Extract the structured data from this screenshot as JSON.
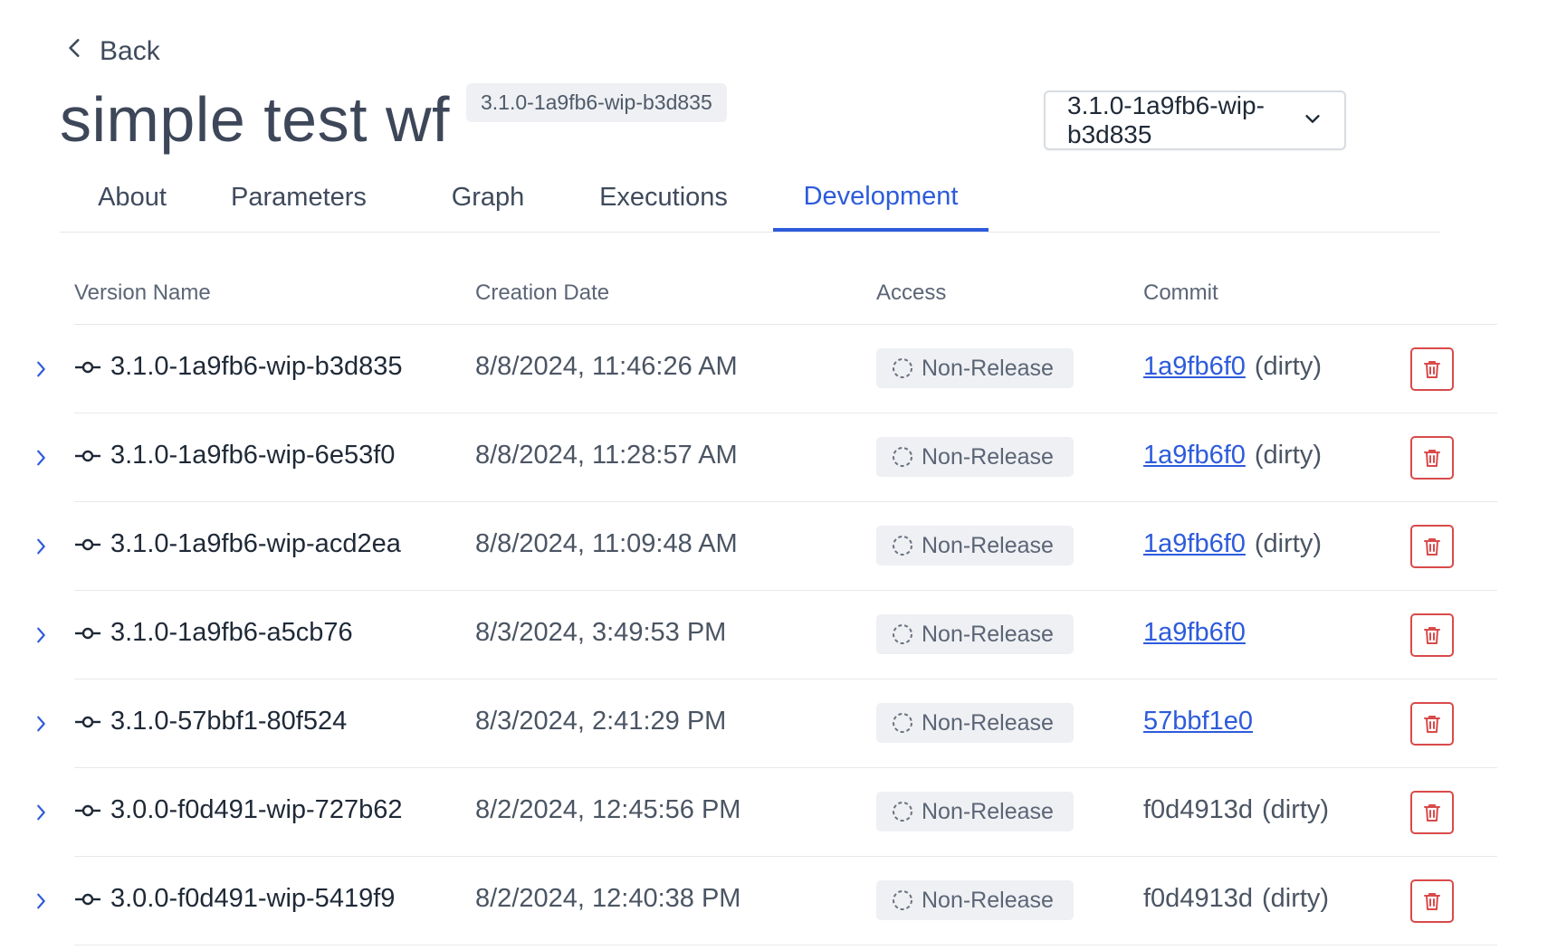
{
  "nav": {
    "back_label": "Back"
  },
  "header": {
    "title": "simple test wf",
    "version_chip": "3.1.0-1a9fb6-wip-b3d835",
    "version_select": "3.1.0-1a9fb6-wip-b3d835"
  },
  "tabs": [
    {
      "label": "About"
    },
    {
      "label": "Parameters"
    },
    {
      "label": "Graph"
    },
    {
      "label": "Executions"
    },
    {
      "label": "Development",
      "active": true
    }
  ],
  "table": {
    "columns": [
      "Version Name",
      "Creation Date",
      "Access",
      "Commit"
    ],
    "rows": [
      {
        "version": "3.1.0-1a9fb6-wip-b3d835",
        "date": "8/8/2024, 11:46:26 AM",
        "access": "Non-Release",
        "commit": "1a9fb6f0",
        "commit_is_link": true,
        "suffix": "(dirty)"
      },
      {
        "version": "3.1.0-1a9fb6-wip-6e53f0",
        "date": "8/8/2024, 11:28:57 AM",
        "access": "Non-Release",
        "commit": "1a9fb6f0",
        "commit_is_link": true,
        "suffix": "(dirty)"
      },
      {
        "version": "3.1.0-1a9fb6-wip-acd2ea",
        "date": "8/8/2024, 11:09:48 AM",
        "access": "Non-Release",
        "commit": "1a9fb6f0",
        "commit_is_link": true,
        "suffix": "(dirty)"
      },
      {
        "version": "3.1.0-1a9fb6-a5cb76",
        "date": "8/3/2024, 3:49:53 PM",
        "access": "Non-Release",
        "commit": "1a9fb6f0",
        "commit_is_link": true,
        "suffix": ""
      },
      {
        "version": "3.1.0-57bbf1-80f524",
        "date": "8/3/2024, 2:41:29 PM",
        "access": "Non-Release",
        "commit": "57bbf1e0",
        "commit_is_link": true,
        "suffix": ""
      },
      {
        "version": "3.0.0-f0d491-wip-727b62",
        "date": "8/2/2024, 12:45:56 PM",
        "access": "Non-Release",
        "commit": "f0d4913d",
        "commit_is_link": false,
        "suffix": "(dirty)"
      },
      {
        "version": "3.0.0-f0d491-wip-5419f9",
        "date": "8/2/2024, 12:40:38 PM",
        "access": "Non-Release",
        "commit": "f0d4913d",
        "commit_is_link": false,
        "suffix": "(dirty)"
      }
    ]
  },
  "colors": {
    "accent": "#2d5bdb",
    "danger": "#d94a4a",
    "badge_bg": "#eef0f3"
  },
  "icons": {
    "back": "chevron-left-icon",
    "select": "chevron-down-icon",
    "expander": "chevron-right-icon",
    "version": "git-commit-icon",
    "access": "dashed-circle-icon",
    "delete": "trash-icon"
  }
}
